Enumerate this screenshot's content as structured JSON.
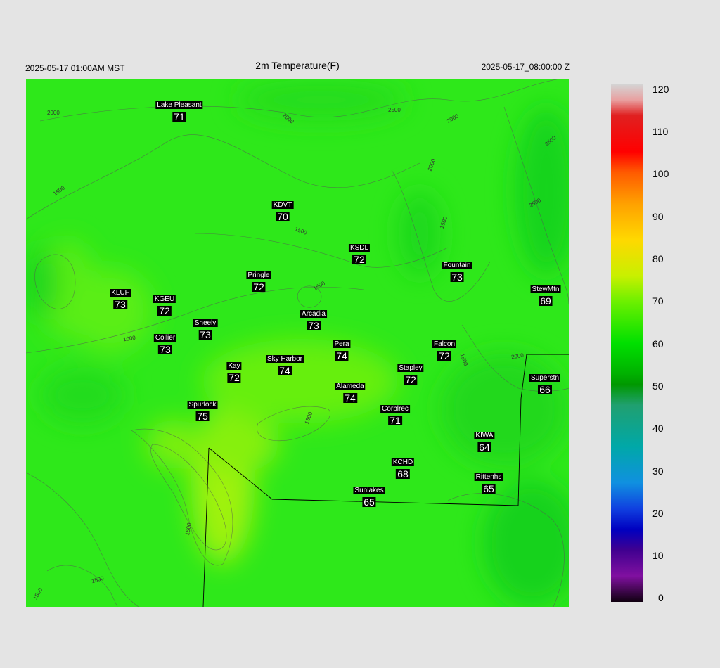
{
  "header": {
    "local_time": "2025-05-17 01:00AM MST",
    "title": "2m Temperature(F)",
    "utc_time": "2025-05-17_08:00:00 Z"
  },
  "stations": [
    {
      "name": "Lake Pleasant",
      "value": "71"
    },
    {
      "name": "KDVT",
      "value": "70"
    },
    {
      "name": "KSDL",
      "value": "72"
    },
    {
      "name": "Fountain",
      "value": "73"
    },
    {
      "name": "Pringle",
      "value": "72"
    },
    {
      "name": "StewMtn",
      "value": "69"
    },
    {
      "name": "KLUF",
      "value": "73"
    },
    {
      "name": "KGEU",
      "value": "72"
    },
    {
      "name": "Arcadia",
      "value": "73"
    },
    {
      "name": "Sheely",
      "value": "73"
    },
    {
      "name": "Collier",
      "value": "73"
    },
    {
      "name": "Pera",
      "value": "74"
    },
    {
      "name": "Falcon",
      "value": "72"
    },
    {
      "name": "Kay",
      "value": "72"
    },
    {
      "name": "Sky Harbor",
      "value": "74"
    },
    {
      "name": "Stapley",
      "value": "72"
    },
    {
      "name": "Superstn",
      "value": "66"
    },
    {
      "name": "Alameda",
      "value": "74"
    },
    {
      "name": "Spurlock",
      "value": "75"
    },
    {
      "name": "Corblrec",
      "value": "71"
    },
    {
      "name": "KIWA",
      "value": "64"
    },
    {
      "name": "KCHD",
      "value": "68"
    },
    {
      "name": "Rittenhs",
      "value": "65"
    },
    {
      "name": "Sunlakes",
      "value": "65"
    }
  ],
  "contour_labels": [
    "2000",
    "2000",
    "2500",
    "2000",
    "2500",
    "2000",
    "2500",
    "1500",
    "1500",
    "1500",
    "1500",
    "1000",
    "2000",
    "1500",
    "1500",
    "1500",
    "1500",
    "1500"
  ],
  "colorbar": {
    "ticks": [
      "120",
      "110",
      "100",
      "90",
      "80",
      "70",
      "60",
      "50",
      "40",
      "30",
      "20",
      "10",
      "0"
    ]
  },
  "colors": {
    "background": "#e4e4e4",
    "map_base": "#2ee81a",
    "warm_patch": "#a8f20a"
  }
}
